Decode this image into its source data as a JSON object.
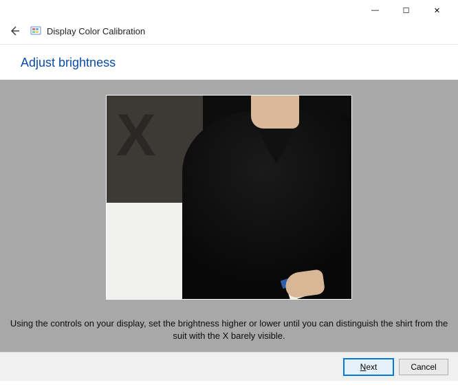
{
  "window": {
    "minimize_glyph": "—",
    "maximize_glyph": "☐",
    "close_glyph": "✕"
  },
  "header": {
    "app_title": "Display Color Calibration"
  },
  "page": {
    "heading": "Adjust brightness"
  },
  "stage": {
    "caption": "Using the controls on your display, set the brightness higher or lower until you can distinguish the shirt from the suit with the X barely visible.",
    "sample_x": "X"
  },
  "footer": {
    "next_prefix": "N",
    "next_rest": "ext",
    "cancel_label": "Cancel"
  }
}
